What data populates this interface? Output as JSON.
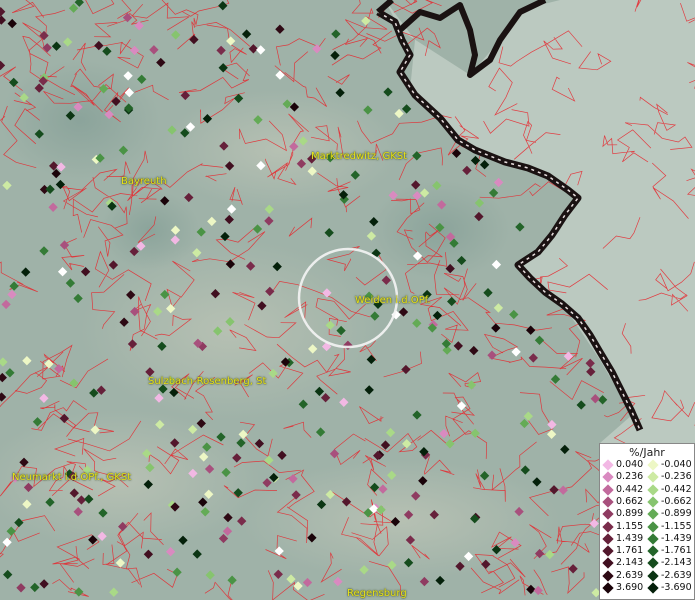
{
  "map": {
    "cities": [
      {
        "id": "bayreuth",
        "label": "Bayreuth"
      },
      {
        "id": "marktredwitz",
        "label": "Marktredwitz, GKSt"
      },
      {
        "id": "weiden",
        "label": "Weiden i.d.OPf."
      },
      {
        "id": "sulzbach",
        "label": "Sulzbach-Rosenberg, St"
      },
      {
        "id": "neumarkt",
        "label": "Neumarkt i.d.OPf., GKSt"
      },
      {
        "id": "regensburg",
        "label": "Regensburg"
      }
    ]
  },
  "legend": {
    "title": "%/Jahr",
    "positive": [
      {
        "value": "0.040",
        "color": "#f2b8e4"
      },
      {
        "value": "0.236",
        "color": "#d98ac0"
      },
      {
        "value": "0.442",
        "color": "#c26a9d"
      },
      {
        "value": "0.662",
        "color": "#a8507d"
      },
      {
        "value": "0.899",
        "color": "#8f3b61"
      },
      {
        "value": "1.155",
        "color": "#7a2c4b"
      },
      {
        "value": "1.439",
        "color": "#66203a"
      },
      {
        "value": "1.761",
        "color": "#53172c"
      },
      {
        "value": "2.143",
        "color": "#410f20"
      },
      {
        "value": "2.639",
        "color": "#2e0914"
      },
      {
        "value": "3.690",
        "color": "#1a0309"
      }
    ],
    "negative": [
      {
        "value": "-0.040",
        "color": "#edf7c5"
      },
      {
        "value": "-0.236",
        "color": "#cdeaa3"
      },
      {
        "value": "-0.442",
        "color": "#a9d987"
      },
      {
        "value": "-0.662",
        "color": "#86c46e"
      },
      {
        "value": "-0.899",
        "color": "#64ab56"
      },
      {
        "value": "-1.155",
        "color": "#4a9345"
      },
      {
        "value": "-1.439",
        "color": "#347b36"
      },
      {
        "value": "-1.761",
        "color": "#236429"
      },
      {
        "value": "-2.143",
        "color": "#154c1d"
      },
      {
        "value": "-2.639",
        "color": "#0b3513"
      },
      {
        "value": "-3.690",
        "color": "#04200a"
      }
    ]
  }
}
